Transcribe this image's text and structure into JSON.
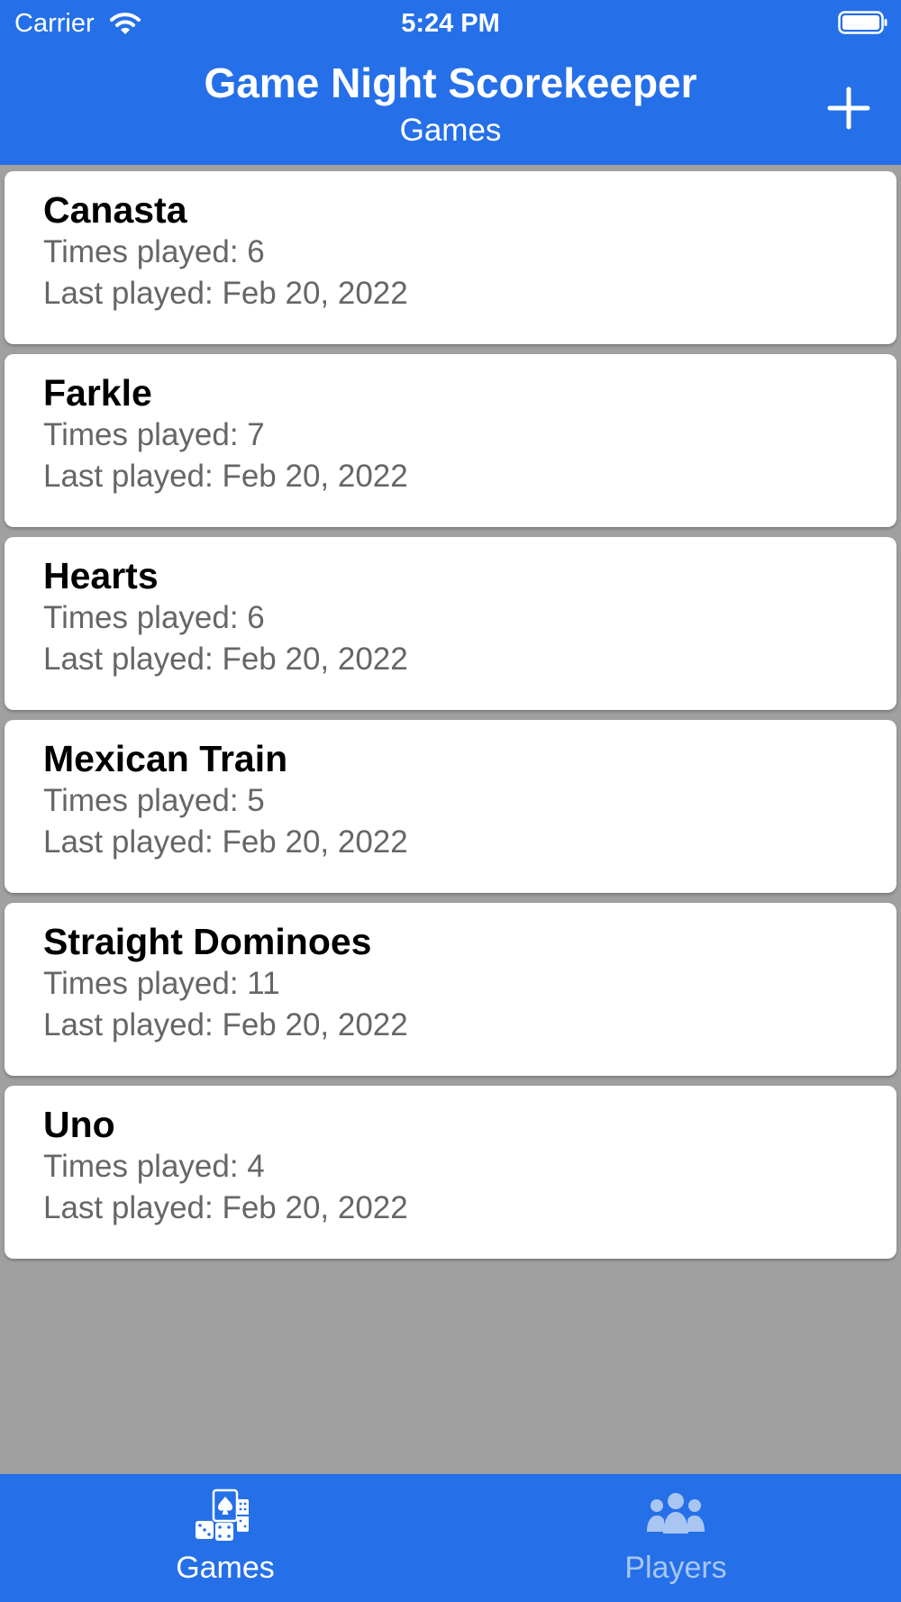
{
  "status_bar": {
    "carrier": "Carrier",
    "time": "5:24 PM",
    "wifi_icon": "wifi-icon",
    "battery_icon": "battery-icon"
  },
  "header": {
    "title": "Game Night Scorekeeper",
    "subtitle": "Games",
    "add_icon": "plus-icon",
    "color": "#2570e8"
  },
  "games": [
    {
      "name": "Canasta",
      "times_played": "Times played: 6",
      "last_played": "Last played: Feb 20, 2022"
    },
    {
      "name": "Farkle",
      "times_played": "Times played: 7",
      "last_played": "Last played: Feb 20, 2022"
    },
    {
      "name": "Hearts",
      "times_played": "Times played: 6",
      "last_played": "Last played: Feb 20, 2022"
    },
    {
      "name": "Mexican Train",
      "times_played": "Times played: 5",
      "last_played": "Last played: Feb 20, 2022"
    },
    {
      "name": "Straight Dominoes",
      "times_played": "Times played: 11",
      "last_played": "Last played: Feb 20, 2022"
    },
    {
      "name": "Uno",
      "times_played": "Times played: 4",
      "last_played": "Last played: Feb 20, 2022"
    }
  ],
  "tab_bar": {
    "tabs": [
      {
        "label": "Games",
        "icon": "cards-dice-icon",
        "selected": true
      },
      {
        "label": "Players",
        "icon": "people-icon",
        "selected": false
      }
    ],
    "active_color": "#ffffff",
    "inactive_color": "#a9c6f3"
  }
}
